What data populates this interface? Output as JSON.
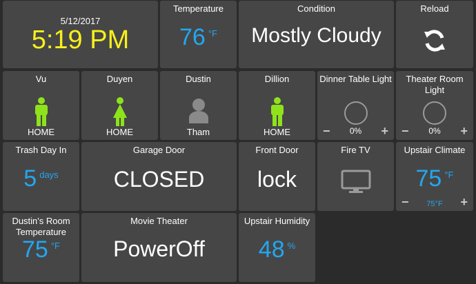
{
  "clock": {
    "date": "5/12/2017",
    "time": "5:19 PM"
  },
  "temperature": {
    "label": "Temperature",
    "value": "76",
    "unit": "°F"
  },
  "condition": {
    "label": "Condition",
    "value": "Mostly Cloudy"
  },
  "reload": {
    "label": "Reload"
  },
  "people": [
    {
      "name": "Vu",
      "status": "HOME",
      "icon": "male-person-icon",
      "color": "#8ee21b"
    },
    {
      "name": "Duyen",
      "status": "HOME",
      "icon": "female-person-icon",
      "color": "#8ee21b"
    },
    {
      "name": "Dustin",
      "status": "Tham",
      "icon": "generic-person-icon",
      "color": "#8a8a8a"
    },
    {
      "name": "Dillion",
      "status": "HOME",
      "icon": "male-person-icon",
      "color": "#8ee21b"
    }
  ],
  "lights": [
    {
      "label": "Dinner Table Light",
      "level": "0%",
      "minus": "−",
      "plus": "+"
    },
    {
      "label": "Theater Room Light",
      "level": "0%",
      "minus": "−",
      "plus": "+"
    }
  ],
  "trash": {
    "label": "Trash Day In",
    "value": "5",
    "unit": "days"
  },
  "garage": {
    "label": "Garage Door",
    "value": "CLOSED"
  },
  "front_door": {
    "label": "Front Door",
    "value": "lock"
  },
  "fire_tv": {
    "label": "Fire TV"
  },
  "upstair_climate": {
    "label": "Upstair Climate",
    "value": "75",
    "unit": "°F",
    "setpoint": "75°F",
    "minus": "−",
    "plus": "+"
  },
  "dustin_room": {
    "label": "Dustin's Room Temperature",
    "value": "75",
    "unit": "°F"
  },
  "movie_theater": {
    "label": "Movie Theater",
    "value": "PowerOff"
  },
  "upstair_humidity": {
    "label": "Upstair Humidity",
    "value": "48",
    "unit": "%"
  },
  "colors": {
    "tile": "#464646",
    "background": "#2b2b2b",
    "accent_blue": "#23a7f0",
    "time_yellow": "#f7f01a",
    "present_green": "#8ee21b"
  }
}
